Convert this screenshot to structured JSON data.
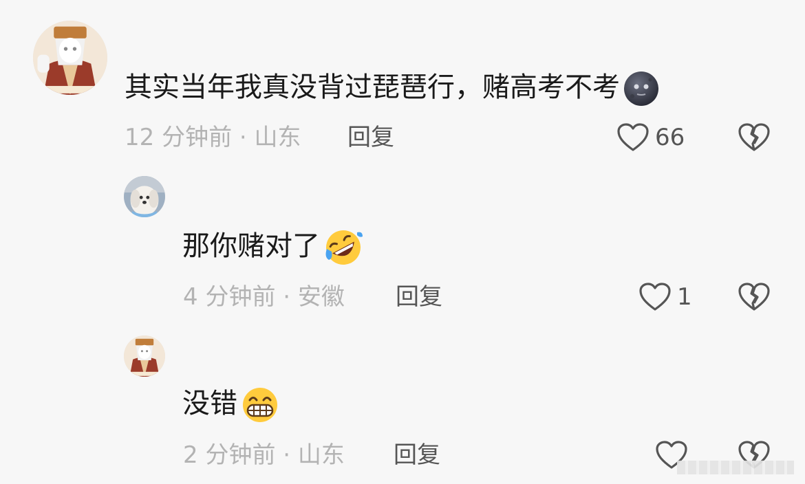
{
  "comments": [
    {
      "text": "其实当年我真没背过琵琶行，赌高考不考",
      "time": "12 分钟前",
      "location": "山东",
      "reply_label": "回复",
      "likes": "66",
      "emoji": "new-moon-face"
    },
    {
      "text": "那你赌对了",
      "time": "4 分钟前",
      "location": "安徽",
      "reply_label": "回复",
      "likes": "1",
      "emoji": "rolling-on-the-floor-laughing"
    },
    {
      "text": "没错",
      "time": "2 分钟前",
      "location": "山东",
      "reply_label": "回复",
      "likes": "",
      "emoji": "grinning-face-with-smiling-eyes"
    }
  ],
  "separator": " · ",
  "colors": {
    "background": "#f7f7f7",
    "text": "#1a1a1a",
    "meta": "#b3b3b3",
    "action": "#555555"
  }
}
